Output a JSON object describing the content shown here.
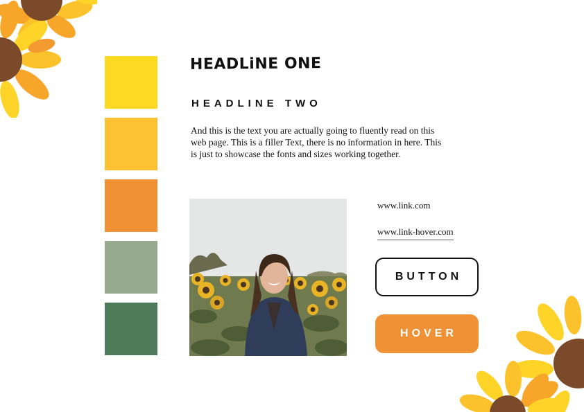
{
  "palette": {
    "colors": [
      "#fdd922",
      "#fdc233",
      "#f19135",
      "#95aa8f",
      "#4d7b59"
    ]
  },
  "headings": {
    "headline_one": "HEADLiNE ONE",
    "headline_two": "HEADLINE TWO"
  },
  "body_text": "And this is the text you are actually going to fluently read on this web page. This is a filler Text, there is no information in here. This is just to showcase the fonts and sizes working together.",
  "links": {
    "default": "www.link.com",
    "hover": "www.link-hover.com"
  },
  "buttons": {
    "default_label": "BUTTON",
    "hover_label": "HOVER",
    "hover_color": "#f19135"
  },
  "decoration": {
    "icon": "sunflower-icon"
  }
}
